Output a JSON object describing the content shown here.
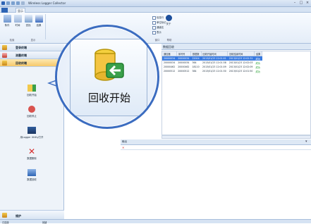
{
  "window": {
    "title": "Wireless Logger Collector"
  },
  "tabs": [
    {
      "label": ""
    },
    {
      "label": "显示"
    }
  ],
  "ribbon": {
    "group1": {
      "buttons": [
        "条件",
        "时间",
        "查找",
        "结果"
      ],
      "label": "检索"
    },
    "group2": {
      "label": "显示"
    },
    "checks": [
      "信息行",
      "单位标记",
      "通道名",
      "表示"
    ],
    "info_button": "关于",
    "window_label": "窗口",
    "help_label": "帮助"
  },
  "sidebar": {
    "headers": [
      "登录终端",
      "测量终端",
      "回收终端"
    ],
    "items": [
      "回收开始",
      "回收停止",
      "用Logger Utility打开",
      "数据删除",
      "数据回收"
    ],
    "footer": "维护"
  },
  "main": {
    "list_title": "数据回收",
    "columns": [
      "通信器",
      "序列号",
      "数据数",
      "回收开始时间",
      "回收结束时间",
      "结果"
    ],
    "rows": [
      [
        "20000034",
        "20000034",
        "22004",
        "2013/01/23 12:01:01",
        "2013/01/23 12:02:31",
        "成功"
      ],
      [
        "20000034",
        "20000034",
        "364",
        "2013/01/23 12:01:38",
        "2013/01/23 12:02:03",
        "成功"
      ],
      [
        "20000462",
        "20000462",
        "18110",
        "2013/01/23 12:01:09",
        "2013/01/23 12:02:09",
        "成功"
      ],
      [
        "20000512",
        "20000512",
        "384",
        "2013/01/23 12:01:30",
        "2013/01/23 12:01:50",
        "成功"
      ]
    ],
    "log_title": "输出"
  },
  "magnifier": {
    "label": "回收开始"
  },
  "status": {
    "left": "已连接",
    "right": "就绪"
  },
  "colors": {
    "accent": "#3b6cc0",
    "selection": "#3a7be0",
    "ok": "#1e9a2a",
    "file_tab": "#2d64b5"
  }
}
